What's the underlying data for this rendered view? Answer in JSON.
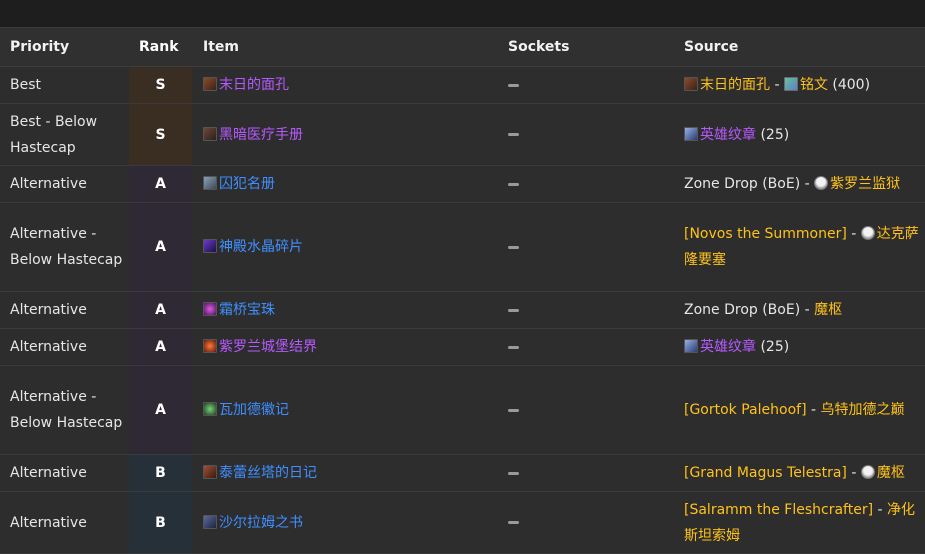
{
  "header": {
    "priority": "Priority",
    "rank": "Rank",
    "item": "Item",
    "sockets": "Sockets",
    "source": "Source"
  },
  "colors": {
    "epic": "#b659ff",
    "rare": "#3f8fff",
    "gold": "#ffc21a",
    "rank_S_bg": "#3a2e22",
    "rank_A_bg": "#2f2835",
    "rank_B_bg": "#263039"
  },
  "rows": [
    {
      "priority": "Best",
      "rank": "S",
      "item": "末日的面孔",
      "item_quality": "epic",
      "item_icon": "face-icon",
      "sockets": "—",
      "source_parts": {
        "a": "末日的面孔",
        "sep": " - ",
        "b": "铭文",
        "c": " (400)"
      }
    },
    {
      "priority": "Best - Below Hastecap",
      "rank": "S",
      "item": "黑暗医疗手册",
      "item_quality": "epic",
      "item_icon": "book-icon",
      "sockets": "—",
      "source_parts": {
        "a": "英雄纹章",
        "c": " (25)"
      }
    },
    {
      "priority": "Alternative",
      "rank": "A",
      "item": "囚犯名册",
      "item_quality": "rare",
      "item_icon": "scroll-icon",
      "sockets": "—",
      "source_parts": {
        "pre": "Zone Drop (BoE)",
        "sep": " - ",
        "b": "紫罗兰监狱"
      }
    },
    {
      "priority": "Alternative - Below Hastecap",
      "rank": "A",
      "item": "神殿水晶碎片",
      "item_quality": "rare",
      "item_icon": "crystal-icon",
      "sockets": "—",
      "source_parts": {
        "a": "[Novos the Summoner]",
        "sep": " - ",
        "b": "达克萨隆要塞"
      }
    },
    {
      "priority": "Alternative",
      "rank": "A",
      "item": "霜桥宝珠",
      "item_quality": "rare",
      "item_icon": "orb-icon",
      "sockets": "—",
      "source_parts": {
        "pre": "Zone Drop (BoE)",
        "sep": " - ",
        "b": "魔枢"
      }
    },
    {
      "priority": "Alternative",
      "rank": "A",
      "item": "紫罗兰城堡结界",
      "item_quality": "epic",
      "item_icon": "ward-icon",
      "sockets": "—",
      "source_parts": {
        "a": "英雄纹章",
        "c": " (25)"
      }
    },
    {
      "priority": "Alternative - Below Hastecap",
      "rank": "A",
      "item": "瓦加德徽记",
      "item_quality": "rare",
      "item_icon": "seal-icon",
      "sockets": "—",
      "source_parts": {
        "a": "[Gortok Palehoof]",
        "sep": " - ",
        "b": "乌特加德之巅"
      }
    },
    {
      "priority": "Alternative",
      "rank": "B",
      "item": "泰蕾丝塔的日记",
      "item_quality": "rare",
      "item_icon": "diary-icon",
      "sockets": "—",
      "source_parts": {
        "a": "[Grand Magus Telestra]",
        "sep": " - ",
        "b": "魔枢"
      }
    },
    {
      "priority": "Alternative",
      "rank": "B",
      "item": "沙尔拉姆之书",
      "item_quality": "rare",
      "item_icon": "tome-icon",
      "sockets": "—",
      "source_parts": {
        "a": "[Salramm the Fleshcrafter]",
        "sep": " - ",
        "b": "净化斯坦索姆"
      }
    }
  ]
}
